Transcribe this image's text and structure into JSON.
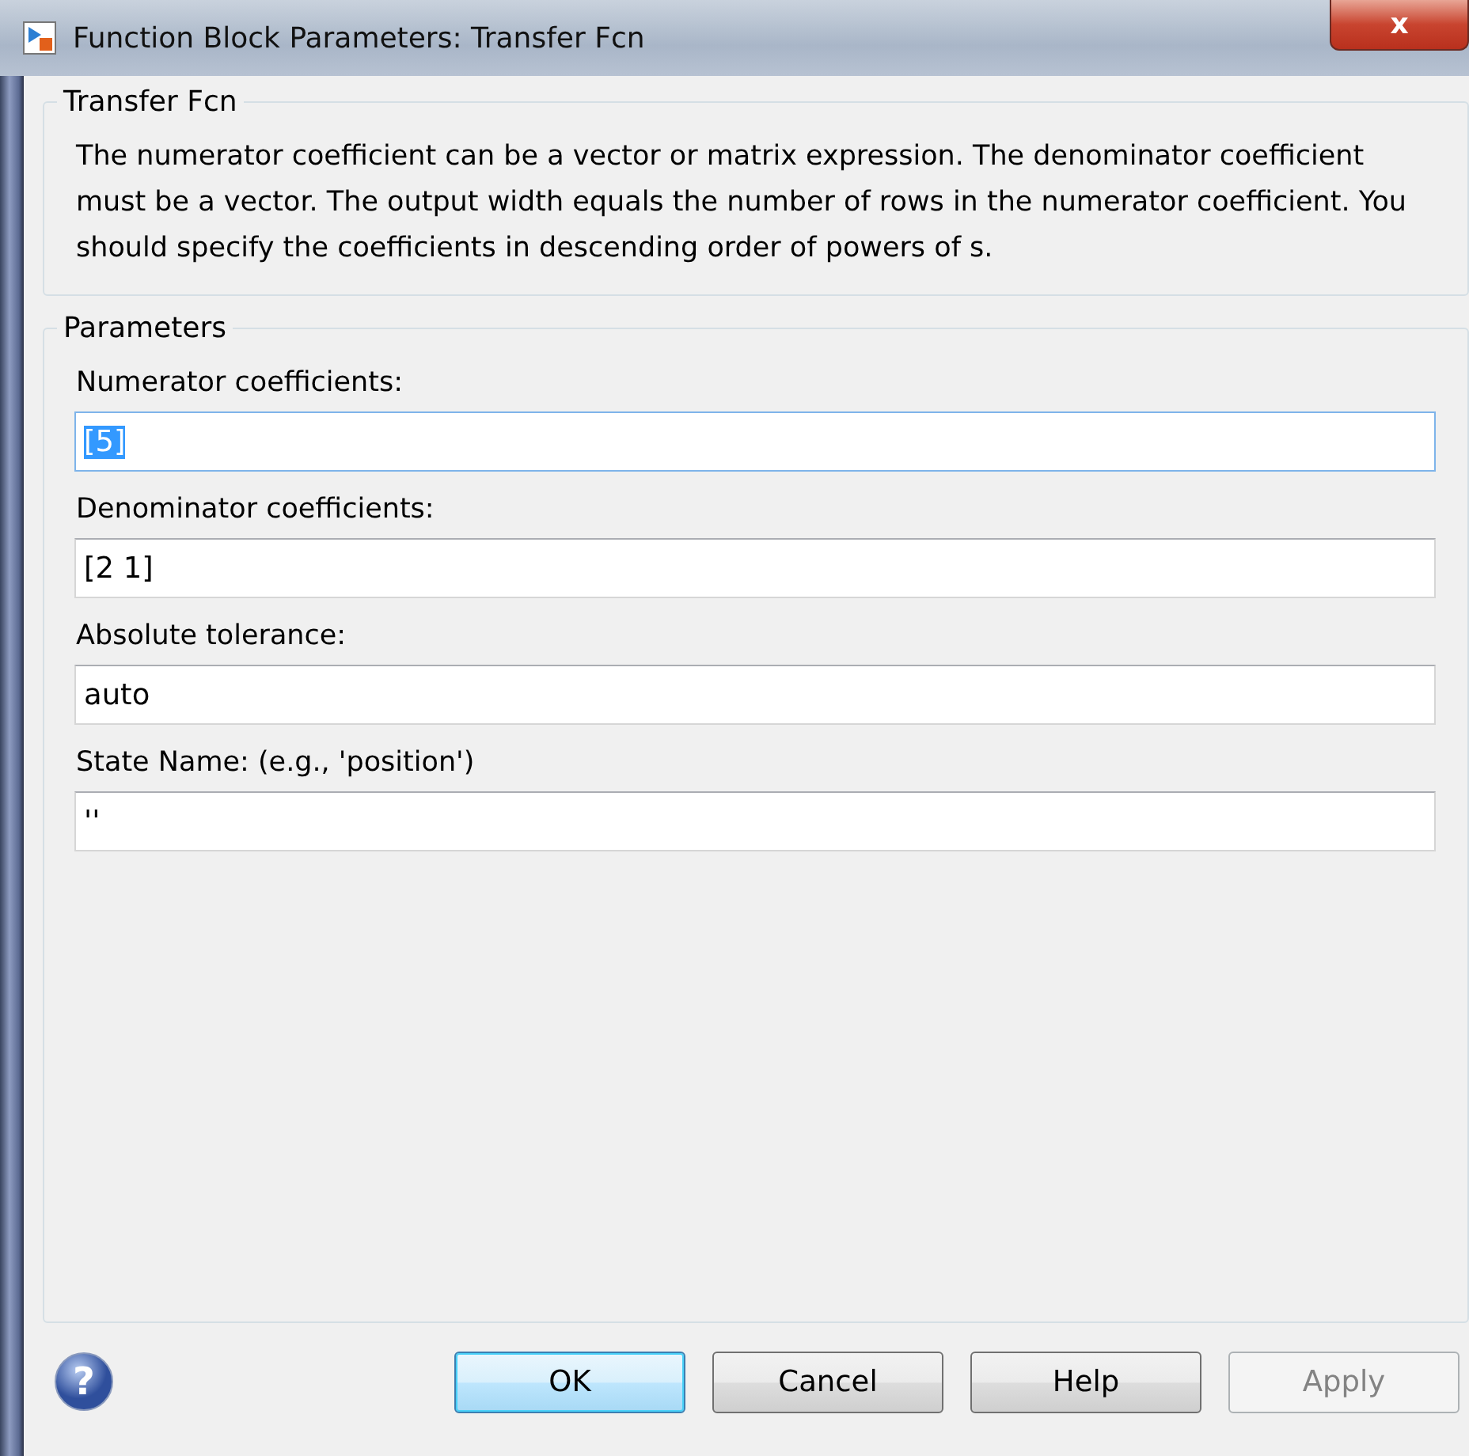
{
  "window": {
    "title": "Function Block Parameters: Transfer Fcn",
    "close": "x"
  },
  "description_group": {
    "title": "Transfer Fcn",
    "text": "The numerator coefficient can be a vector or matrix expression. The denominator coefficient must be a vector. The output width equals the number of rows in the numerator coefficient. You should specify the coefficients in descending order of powers of s."
  },
  "parameters_group": {
    "title": "Parameters",
    "fields": [
      {
        "label": "Numerator coefficients:",
        "value": "[5]",
        "text_selected": true
      },
      {
        "label": "Denominator coefficients:",
        "value": "[2 1]",
        "text_selected": false
      },
      {
        "label": "Absolute tolerance:",
        "value": "auto",
        "text_selected": false
      },
      {
        "label": "State Name: (e.g., 'position')",
        "value": "''",
        "text_selected": false
      }
    ]
  },
  "help_icon": "?",
  "buttons": [
    {
      "label": "OK",
      "default": true,
      "disabled": false
    },
    {
      "label": "Cancel",
      "default": false,
      "disabled": false
    },
    {
      "label": "Help",
      "default": false,
      "disabled": false
    },
    {
      "label": "Apply",
      "default": false,
      "disabled": true
    }
  ]
}
